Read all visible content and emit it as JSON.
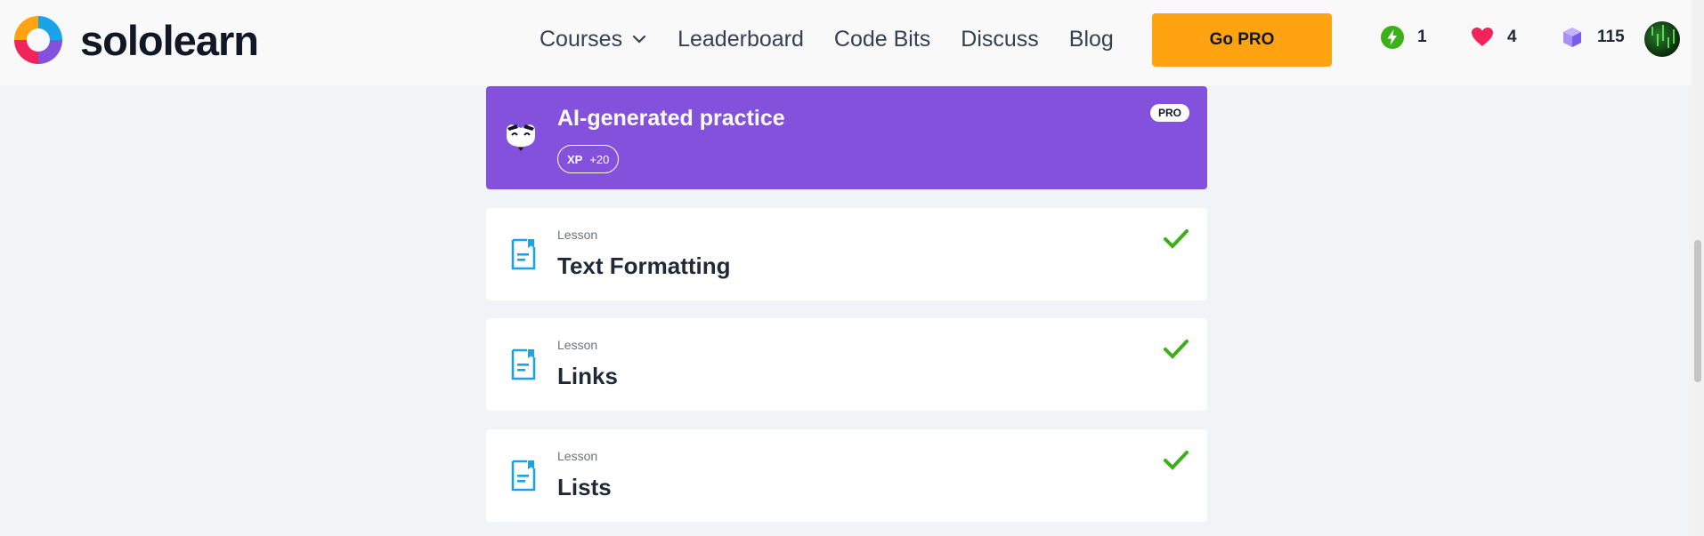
{
  "brand": {
    "name": "sololearn"
  },
  "nav": {
    "courses": "Courses",
    "leaderboard": "Leaderboard",
    "code_bits": "Code Bits",
    "discuss": "Discuss",
    "blog": "Blog"
  },
  "cta": {
    "go_pro": "Go PRO"
  },
  "stats": {
    "streak": "1",
    "hearts": "4",
    "gems": "115"
  },
  "practice": {
    "title": "AI-generated practice",
    "xp_label": "XP",
    "xp_value": "+20",
    "badge": "PRO",
    "icon": "mascot-icon"
  },
  "lessons": [
    {
      "kind": "Lesson",
      "name": "Text Formatting",
      "completed": true
    },
    {
      "kind": "Lesson",
      "name": "Links",
      "completed": true
    },
    {
      "kind": "Lesson",
      "name": "Lists",
      "completed": true
    }
  ],
  "colors": {
    "accent_purple": "#8351dc",
    "go_pro": "#ffa310",
    "check_green": "#3cb01a",
    "doc_blue": "#1ba3e8",
    "heart": "#f0245a",
    "streak": "#3cb01a",
    "gem": "#8a6df0"
  }
}
